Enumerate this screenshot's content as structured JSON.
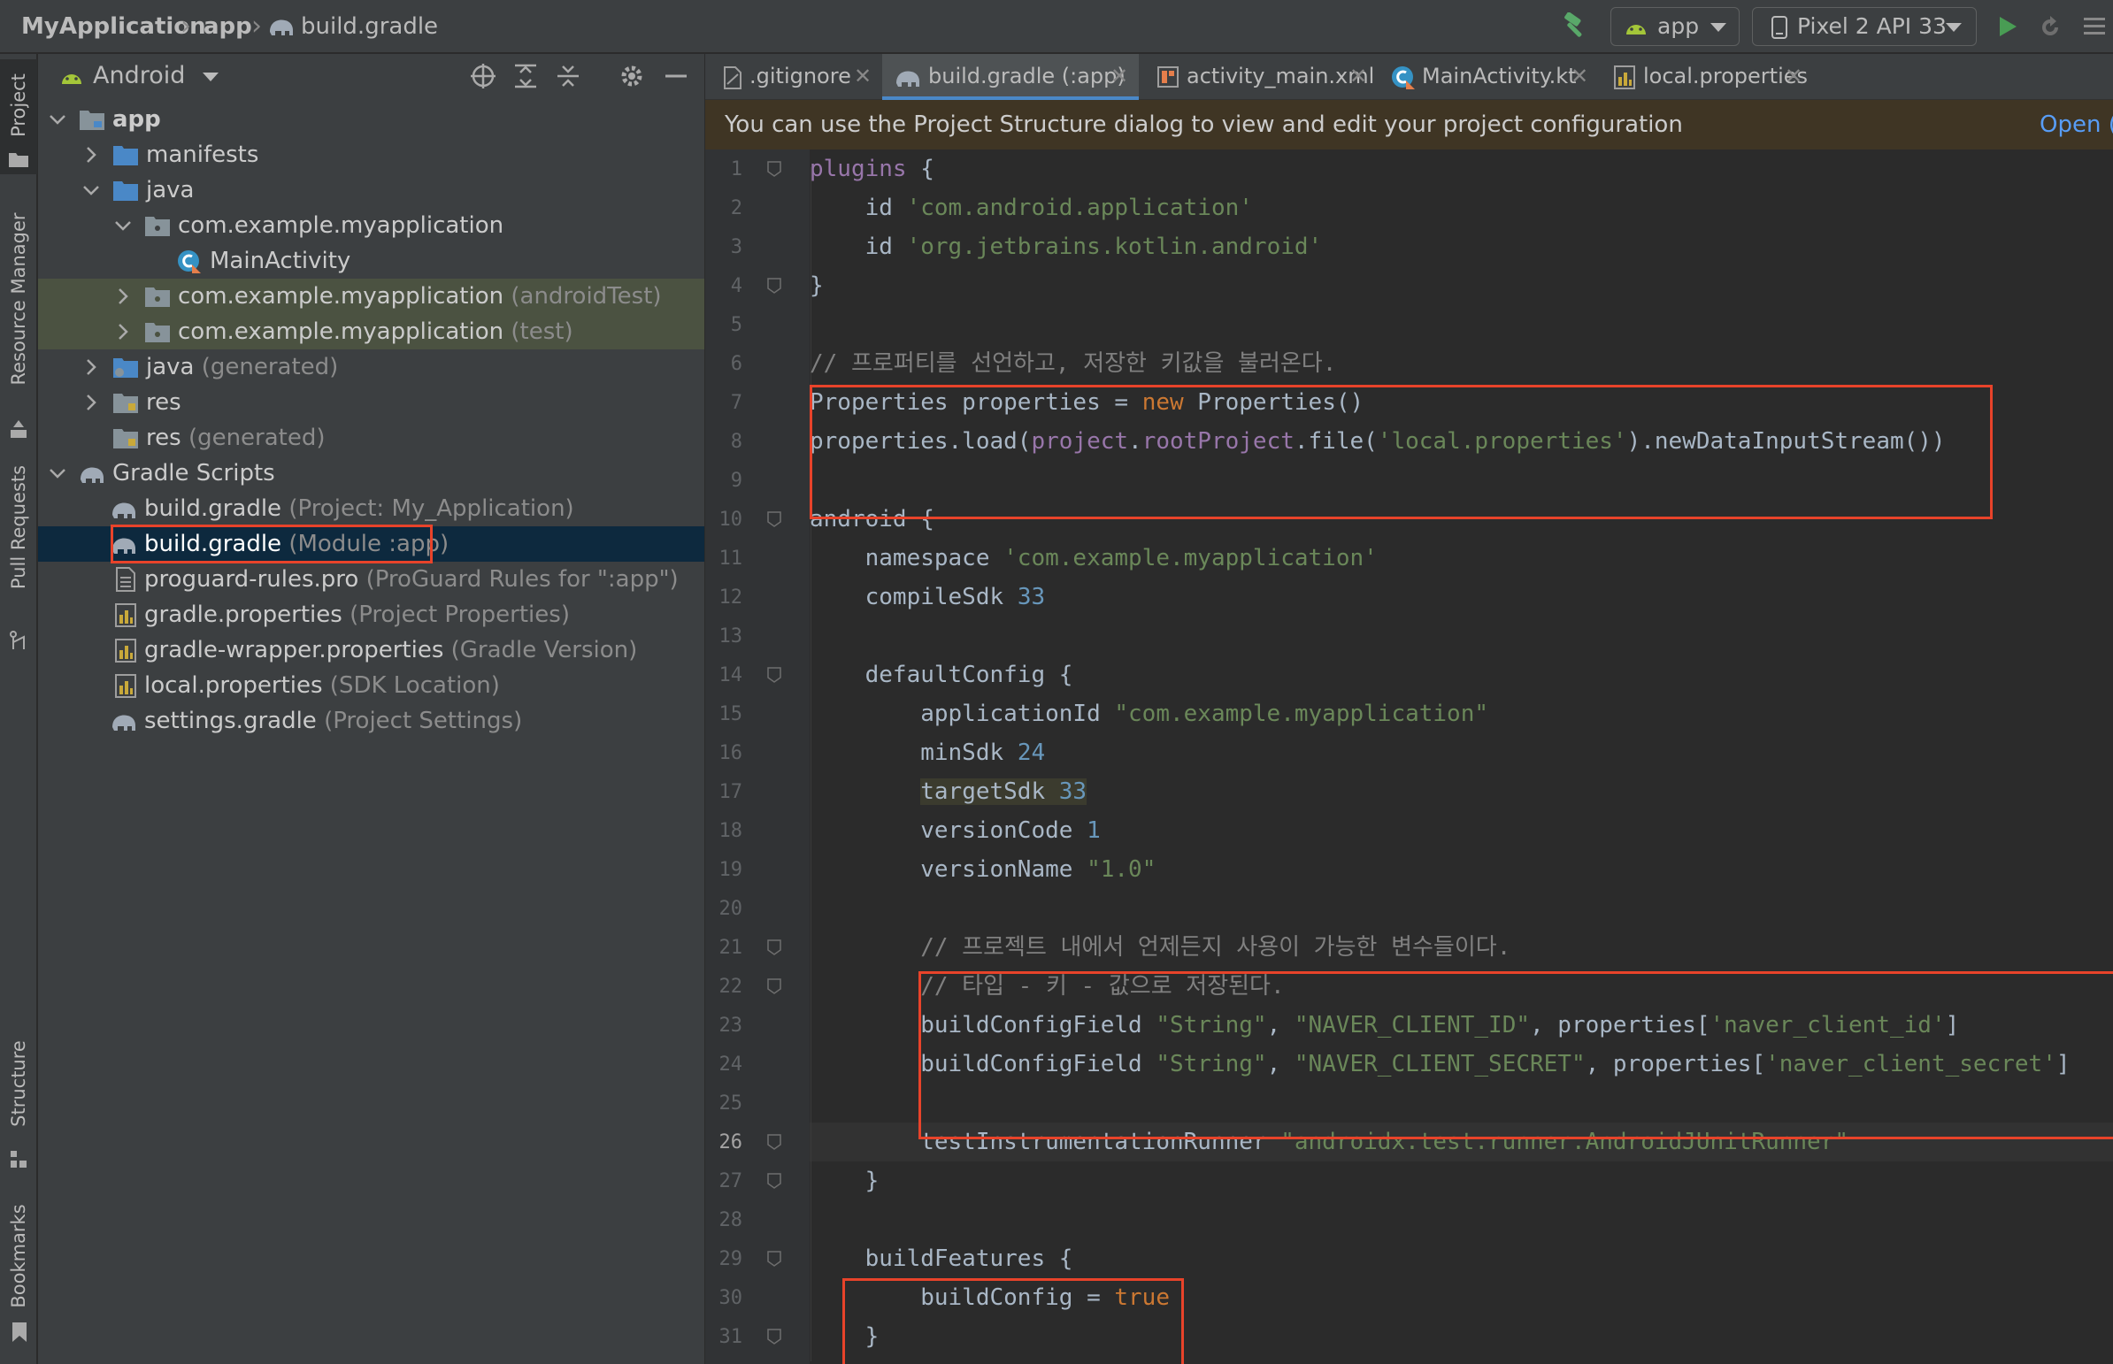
{
  "navbar": {
    "breadcrumbs": [
      "MyApplication",
      "app",
      "build.gradle"
    ],
    "run_config": "app",
    "device": "Pixel 2 API 33"
  },
  "toolstrip": {
    "tabs": [
      "Project",
      "Resource Manager",
      "Pull Requests",
      "Structure",
      "Bookmarks"
    ]
  },
  "project_panel": {
    "view_mode": "Android",
    "tree": [
      {
        "label": "app",
        "hint": ""
      },
      {
        "label": "manifests",
        "hint": ""
      },
      {
        "label": "java",
        "hint": ""
      },
      {
        "label": "com.example.myapplication",
        "hint": ""
      },
      {
        "label": "MainActivity",
        "hint": ""
      },
      {
        "label": "com.example.myapplication",
        "hint": "(androidTest)"
      },
      {
        "label": "com.example.myapplication",
        "hint": "(test)"
      },
      {
        "label": "java",
        "hint": "(generated)"
      },
      {
        "label": "res",
        "hint": ""
      },
      {
        "label": "res",
        "hint": "(generated)"
      },
      {
        "label": "Gradle Scripts",
        "hint": ""
      },
      {
        "label": "build.gradle",
        "hint": "(Project: My_Application)"
      },
      {
        "label": "build.gradle",
        "hint": "(Module :app)"
      },
      {
        "label": "proguard-rules.pro",
        "hint": "(ProGuard Rules for \":app\")"
      },
      {
        "label": "gradle.properties",
        "hint": "(Project Properties)"
      },
      {
        "label": "gradle-wrapper.properties",
        "hint": "(Gradle Version)"
      },
      {
        "label": "local.properties",
        "hint": "(SDK Location)"
      },
      {
        "label": "settings.gradle",
        "hint": "(Project Settings)"
      }
    ]
  },
  "editor": {
    "tabs": [
      ".gitignore",
      "build.gradle (:app)",
      "activity_main.xml",
      "MainActivity.kt",
      "local.properties"
    ],
    "banner": {
      "message": "You can use the Project Structure dialog to view and edit your project configuration",
      "link": "Open ("
    },
    "line_numbers": [
      "1",
      "2",
      "3",
      "4",
      "5",
      "6",
      "7",
      "8",
      "9",
      "10",
      "11",
      "12",
      "13",
      "14",
      "15",
      "16",
      "17",
      "18",
      "19",
      "20",
      "21",
      "22",
      "23",
      "24",
      "25",
      "26",
      "27",
      "28",
      "29",
      "30",
      "31"
    ],
    "code": {
      "l1": [
        "plugins",
        " {"
      ],
      "l2": [
        "    id ",
        "'com.android.application'"
      ],
      "l3": [
        "    id ",
        "'org.jetbrains.kotlin.android'"
      ],
      "l4": [
        "}"
      ],
      "l6": [
        "// 프로퍼티를 선언하고, 저장한 키값을 불러온다."
      ],
      "l7": [
        "Properties properties = ",
        "new",
        " Properties()"
      ],
      "l8": [
        "properties.load(",
        "project",
        ".",
        "rootProject",
        ".file(",
        "'local.properties'",
        ").newDataInputStream())"
      ],
      "l10": [
        "android {"
      ],
      "l11": [
        "    namespace ",
        "'com.example.myapplication'"
      ],
      "l12": [
        "    compileSdk ",
        "33"
      ],
      "l14": [
        "    defaultConfig {"
      ],
      "l15": [
        "        applicationId ",
        "\"com.example.myapplication\""
      ],
      "l16": [
        "        minSdk ",
        "24"
      ],
      "l17": [
        "        ",
        "targetSdk ",
        "33"
      ],
      "l18": [
        "        versionCode ",
        "1"
      ],
      "l19": [
        "        versionName ",
        "\"1.0\""
      ],
      "l21": [
        "        // 프로젝트 내에서 언제든지 사용이 가능한 변수들이다."
      ],
      "l22": [
        "        // 타입 - 키 - 값으로 저장된다."
      ],
      "l23": [
        "        buildConfigField ",
        "\"String\"",
        ", ",
        "\"NAVER_CLIENT_ID\"",
        ", properties[",
        "'naver_client_id'",
        "]"
      ],
      "l24": [
        "        buildConfigField ",
        "\"String\"",
        ", ",
        "\"NAVER_CLIENT_SECRET\"",
        ", properties[",
        "'naver_client_secret'",
        "]"
      ],
      "l26": [
        "        testInstrumentationRunner ",
        "\"androidx.test.runner.AndroidJUnitRunner\""
      ],
      "l27": [
        "    }"
      ],
      "l29": [
        "    buildFeatures {"
      ],
      "l30": [
        "        buildConfig = ",
        "true"
      ],
      "l31": [
        "    }"
      ]
    }
  },
  "colors": {
    "highlight_box": "#e8432a",
    "selection": "#0d293e",
    "keyword": "#cc7832",
    "string": "#6a8759",
    "number": "#6897bb"
  }
}
